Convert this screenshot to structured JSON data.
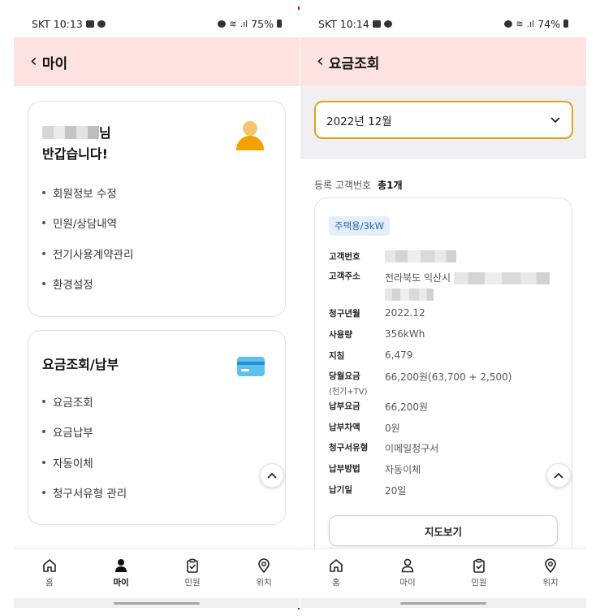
{
  "left": {
    "status": {
      "carrier_time": "SKT 10:13",
      "battery": "75%"
    },
    "header": {
      "title": "마이"
    },
    "greeting": {
      "suffix": "님",
      "line2": "반갑습니다!"
    },
    "my_menu": [
      "회원정보 수정",
      "민원/상담내역",
      "전기사용계약관리",
      "환경설정"
    ],
    "billing": {
      "title": "요금조회/납부",
      "menu": [
        "요금조회",
        "요금납부",
        "자동이체",
        "청구서유형 관리"
      ]
    },
    "nav": [
      {
        "label": "홈",
        "icon": "home-icon"
      },
      {
        "label": "마이",
        "icon": "person-icon"
      },
      {
        "label": "민원",
        "icon": "clipboard-check-icon"
      },
      {
        "label": "위치",
        "icon": "location-pin-icon"
      }
    ]
  },
  "right": {
    "status": {
      "carrier_time": "SKT 10:14",
      "battery": "74%"
    },
    "header": {
      "title": "요금조회"
    },
    "month_select": {
      "value": "2022년 12월"
    },
    "registered": {
      "label": "등록 고객번호",
      "count": "총1개"
    },
    "bill": {
      "badge": "주택용/3kW",
      "customer_no_label": "고객번호",
      "address_label": "고객주소",
      "address_value": "전라북도 익산시",
      "rows": [
        {
          "label": "청구년월",
          "value": "2022.12"
        },
        {
          "label": "사용량",
          "value": "356kWh"
        },
        {
          "label": "지침",
          "value": "6,479"
        },
        {
          "label": "당월요금",
          "sublabel": "(전기+TV)",
          "value": "66,200원(63,700 + 2,500)"
        },
        {
          "label": "납부요금",
          "value": "66,200원"
        },
        {
          "label": "납부차액",
          "value": "0원"
        },
        {
          "label": "청구서유형",
          "value": "이메일청구서"
        },
        {
          "label": "납부방법",
          "value": "자동이체"
        },
        {
          "label": "납기일",
          "value": "20일"
        }
      ],
      "map_button": "지도보기"
    },
    "nav": [
      {
        "label": "홈",
        "icon": "home-icon"
      },
      {
        "label": "마이",
        "icon": "person-icon"
      },
      {
        "label": "민원",
        "icon": "clipboard-check-icon"
      },
      {
        "label": "위치",
        "icon": "location-pin-icon"
      }
    ]
  },
  "colors": {
    "header_bg": "#fde2e2",
    "accent": "#e0a41c",
    "divider": "#c8102e",
    "badge_bg": "#e3f0fb"
  }
}
